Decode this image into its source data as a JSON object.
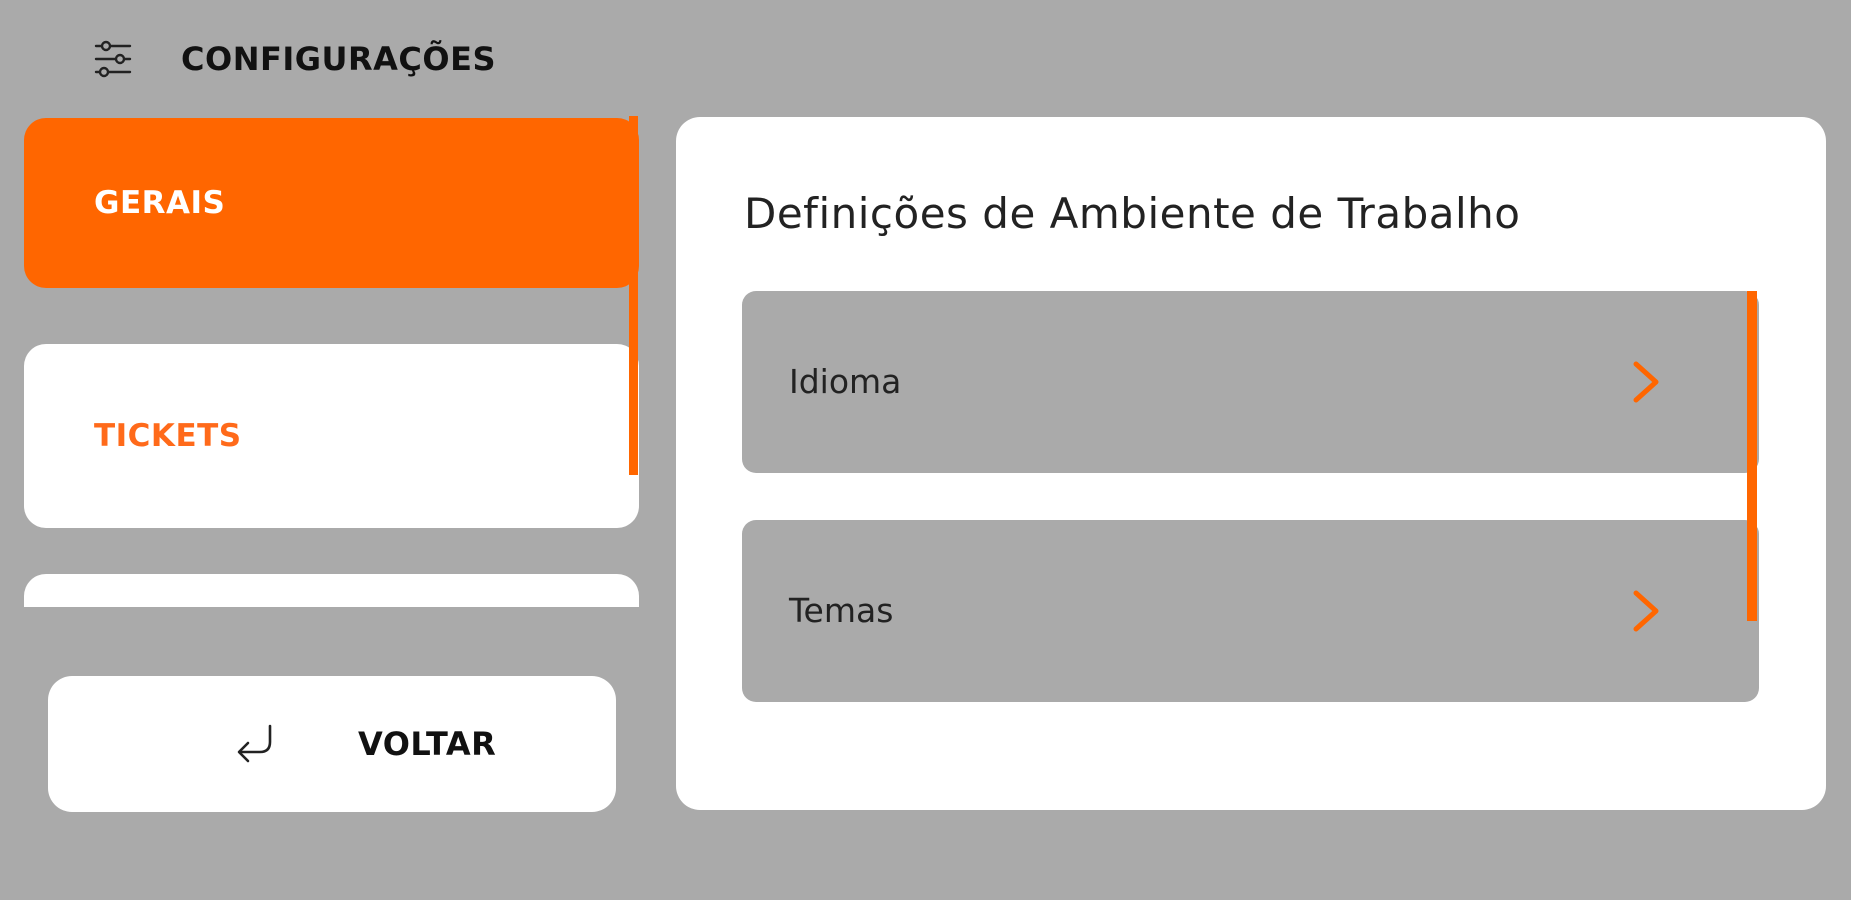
{
  "header": {
    "title": "CONFIGURAÇÕES",
    "icon": "sliders-icon"
  },
  "nav": {
    "items": [
      {
        "label": "GERAIS",
        "active": true
      },
      {
        "label": "TICKETS",
        "active": false
      },
      {
        "label": "",
        "active": false
      }
    ]
  },
  "back_button": {
    "label": "VOLTAR",
    "icon": "return-arrow-icon"
  },
  "panel": {
    "title": "Definições de Ambiente de Trabalho",
    "rows": [
      {
        "label": "Idioma",
        "icon": "chevron-right-icon"
      },
      {
        "label": "Temas",
        "icon": "chevron-right-icon"
      }
    ]
  },
  "colors": {
    "background": "#aaaaaa",
    "accent": "#ff6600",
    "surface": "#ffffff",
    "text": "#111111"
  }
}
